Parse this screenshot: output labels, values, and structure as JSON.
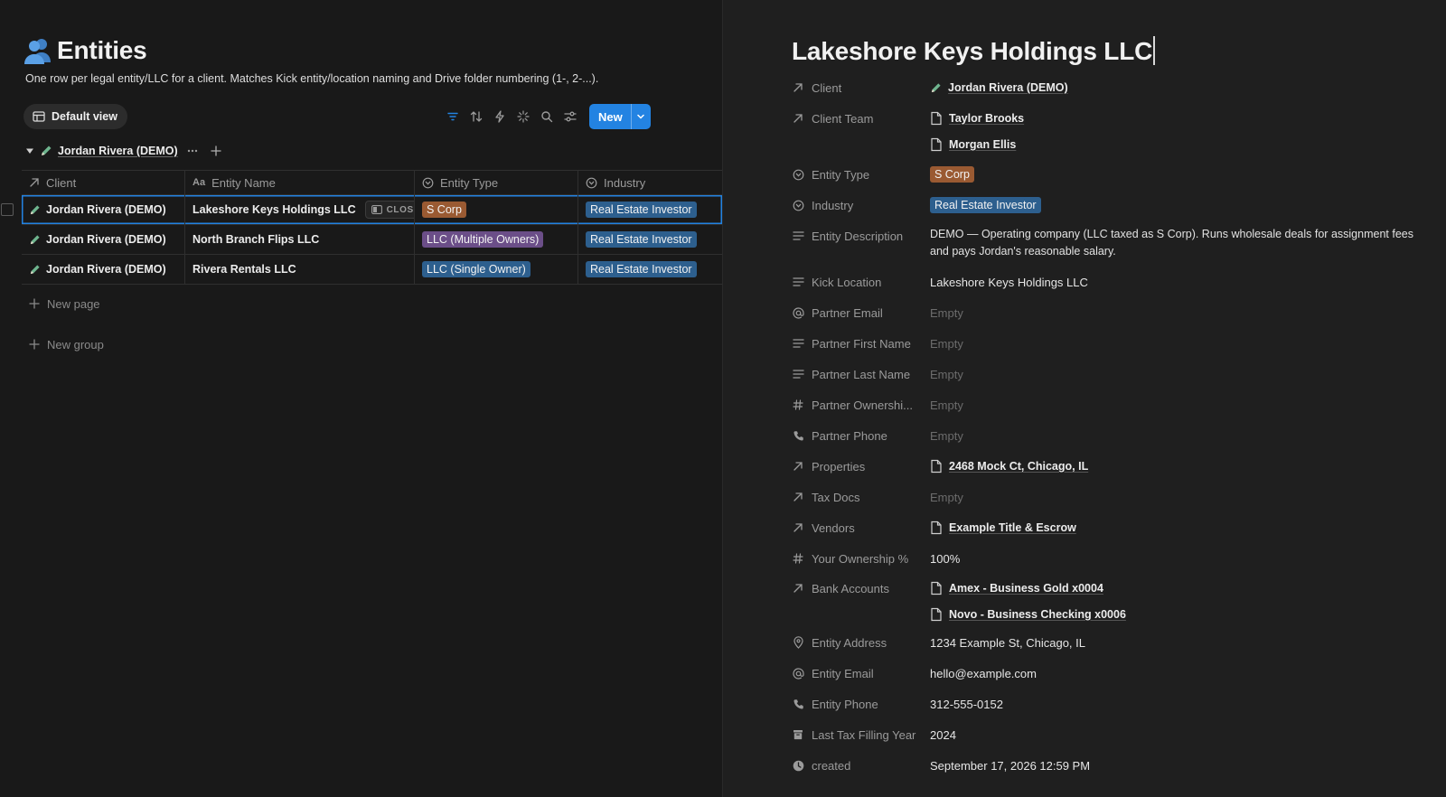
{
  "database": {
    "title": "Entities",
    "description": "One row per legal entity/LLC for a client. Matches Kick entity/location naming and Drive folder numbering (1-, 2-...).",
    "view_label": "Default view",
    "new_button_label": "New",
    "group_label": "Jordan Rivera (DEMO)",
    "columns": [
      "Client",
      "Entity Name",
      "Entity Type",
      "Industry"
    ],
    "rows": [
      {
        "client": "Jordan Rivera (DEMO)",
        "entity_name": "Lakeshore Keys Holdings LLC",
        "entity_type": "S Corp",
        "industry": "Real Estate Investor"
      },
      {
        "client": "Jordan Rivera (DEMO)",
        "entity_name": "North Branch Flips LLC",
        "entity_type": "LLC (Multiple Owners)",
        "industry": "Real Estate Investor"
      },
      {
        "client": "Jordan Rivera (DEMO)",
        "entity_name": "Rivera Rentals LLC",
        "entity_type": "LLC (Single Owner)",
        "industry": "Real Estate Investor"
      }
    ],
    "close_label": "CLOSE",
    "new_page_label": "New page",
    "new_group_label": "New group"
  },
  "colors": {
    "accent": "#2383e2",
    "tag_s_corp": "#9a5a32",
    "tag_llc_multi": "#6b4e88",
    "tag_llc_single": "#2d5f8e",
    "tag_industry": "#2d5f8e"
  },
  "detail": {
    "title": "Lakeshore Keys Holdings LLC",
    "properties": {
      "client": {
        "name": "Client",
        "value": "Jordan Rivera (DEMO)"
      },
      "client_team": {
        "name": "Client Team",
        "values": [
          "Taylor Brooks",
          "Morgan Ellis"
        ]
      },
      "entity_type": {
        "name": "Entity Type",
        "value": "S Corp"
      },
      "industry": {
        "name": "Industry",
        "value": "Real Estate Investor"
      },
      "entity_description": {
        "name": "Entity Description",
        "value": "DEMO — Operating company (LLC taxed as S Corp). Runs wholesale deals for assignment fees and pays Jordan's reasonable salary."
      },
      "kick_location": {
        "name": "Kick Location",
        "value": "Lakeshore Keys Holdings LLC"
      },
      "partner_email": {
        "name": "Partner Email",
        "value": "Empty"
      },
      "partner_first_name": {
        "name": "Partner First Name",
        "value": "Empty"
      },
      "partner_last_name": {
        "name": "Partner Last Name",
        "value": "Empty"
      },
      "partner_ownership": {
        "name": "Partner Ownershi...",
        "value": "Empty"
      },
      "partner_phone": {
        "name": "Partner Phone",
        "value": "Empty"
      },
      "properties": {
        "name": "Properties",
        "value": "2468 Mock Ct, Chicago, IL"
      },
      "tax_docs": {
        "name": "Tax Docs",
        "value": "Empty"
      },
      "vendors": {
        "name": "Vendors",
        "value": "Example Title & Escrow"
      },
      "your_ownership": {
        "name": "Your Ownership %",
        "value": "100%"
      },
      "bank_accounts": {
        "name": "Bank Accounts",
        "values": [
          "Amex - Business Gold x0004",
          "Novo - Business Checking x0006"
        ]
      },
      "entity_address": {
        "name": "Entity Address",
        "value": "1234 Example St, Chicago, IL"
      },
      "entity_email": {
        "name": "Entity Email",
        "value": "hello@example.com"
      },
      "entity_phone": {
        "name": "Entity Phone",
        "value": "312-555-0152"
      },
      "last_tax_filing_year": {
        "name": "Last Tax Filling Year",
        "value": "2024"
      },
      "created": {
        "name": "created",
        "value": "September 17, 2026 12:59 PM"
      }
    }
  }
}
